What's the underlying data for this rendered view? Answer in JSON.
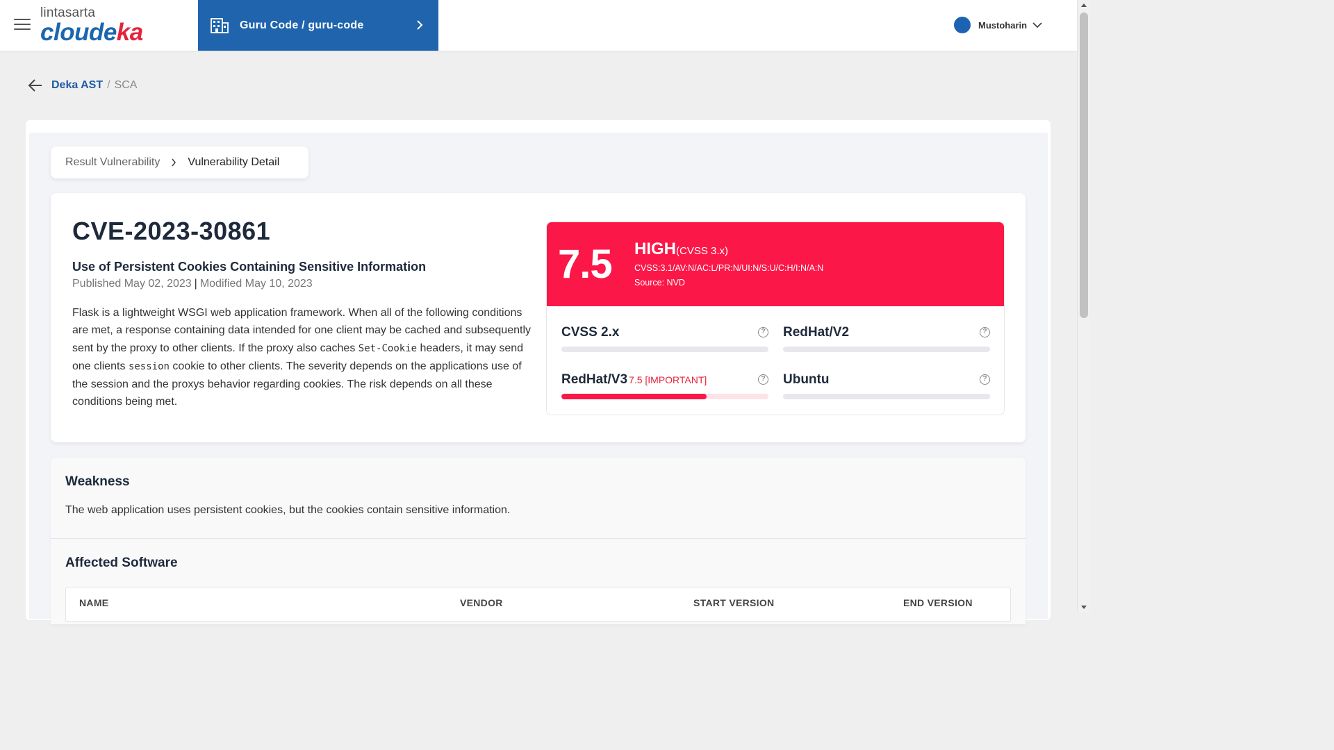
{
  "header": {
    "logo_top": "lintasarta",
    "logo_main": "cloude",
    "logo_accent": "ka",
    "org_label": "Guru Code / guru-code",
    "user_name": "Mustoharin"
  },
  "page_breadcrumb": {
    "parent": "Deka AST",
    "separator": "/",
    "current": "SCA"
  },
  "tab_breadcrumb": {
    "parent": "Result Vulnerability",
    "current": "Vulnerability Detail"
  },
  "cve": {
    "id": "CVE-2023-30861",
    "title": "Use of Persistent Cookies Containing Sensitive Information",
    "published": "Published May 02, 2023",
    "modified": "Modified May 10, 2023",
    "description": {
      "p1": "Flask is a lightweight WSGI web application framework. When all of the following conditions are met, a response containing data intended for one client may be cached and subsequently sent by the proxy to other clients. If the proxy also caches ",
      "code1": "Set-Cookie",
      "p2": " headers, it may send one clients ",
      "code2": "session",
      "p3": " cookie to other clients. The severity depends on the applications use of the session and the proxys behavior regarding cookies. The risk depends on all these conditions being met."
    }
  },
  "score": {
    "value": "7.5",
    "severity": "HIGH",
    "version": "(CVSS 3.x)",
    "vector": "CVSS:3.1/AV:N/AC:L/PR:N/UI:N/S:U/C:H/I:N/A:N",
    "source": "Source: NVD",
    "color": "#fb1747",
    "metrics": [
      {
        "label": "CVSS 2.x",
        "value": "",
        "fill": 0
      },
      {
        "label": "RedHat/V2",
        "value": "",
        "fill": 0
      },
      {
        "label": "RedHat/V3",
        "value": "7.5 [IMPORTANT]",
        "fill": 0.7
      },
      {
        "label": "Ubuntu",
        "value": "",
        "fill": 0
      }
    ]
  },
  "weakness": {
    "title": "Weakness",
    "text": "The web application uses persistent cookies, but the cookies contain sensitive information."
  },
  "affected": {
    "title": "Affected Software",
    "columns": [
      "NAME",
      "VENDOR",
      "START VERSION",
      "END VERSION"
    ]
  }
}
